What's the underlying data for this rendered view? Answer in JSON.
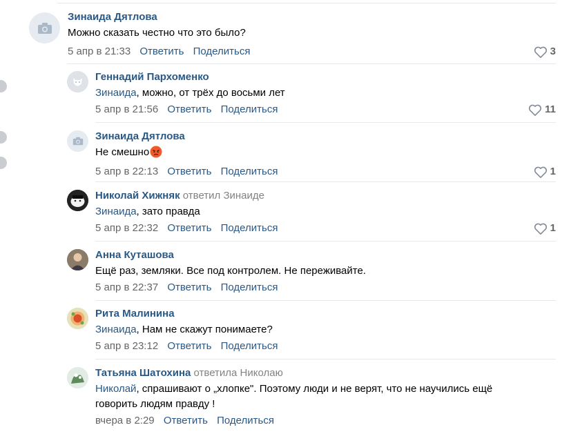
{
  "actions": {
    "reply": "Ответить",
    "share": "Поделиться"
  },
  "colors": {
    "link": "#2a5885",
    "meta": "#656565",
    "divider": "#e7e8ec"
  },
  "comments": [
    {
      "author": "Зинаида Дятлова",
      "text": "Можно сказать честно что это было?",
      "time": "5 апр в 21:33",
      "likes": "3",
      "avatar": "camera-placeholder"
    },
    {
      "author": "Геннадий Пархоменко",
      "mention": "Зинаида",
      "text": ", можно, от трёх до восьми лет",
      "time": "5 апр в 21:56",
      "likes": "11",
      "avatar": "dog-placeholder"
    },
    {
      "author": "Зинаида Дятлова",
      "text": "Не смешно",
      "emoji": "angry-face",
      "time": "5 апр в 22:13",
      "likes": "1",
      "avatar": "camera-placeholder"
    },
    {
      "author": "Николай Хижняк",
      "answered": "ответил Зинаиде",
      "mention": "Зинаида",
      "text": ", зато правда",
      "time": "5 апр в 22:32",
      "likes": "1",
      "avatar": "photo"
    },
    {
      "author": "Анна Куташова",
      "text": "Ещё раз, земляки. Все под контролем. Не переживайте.",
      "time": "5 апр в 22:37",
      "avatar": "photo"
    },
    {
      "author": "Рита Малинина",
      "mention": "Зинаида",
      "text": ", Нам не скажут понимаете?",
      "time": "5 апр в 23:12",
      "avatar": "photo"
    },
    {
      "author": "Татьяна Шатохина",
      "answered": "ответила Николаю",
      "mention": "Николай",
      "text": ", спрашивают о „хлопке\". Поэтому люди и не верят, что не научились ещё говорить людям правду !",
      "time": "вчера в 2:29",
      "avatar": "photo"
    }
  ]
}
